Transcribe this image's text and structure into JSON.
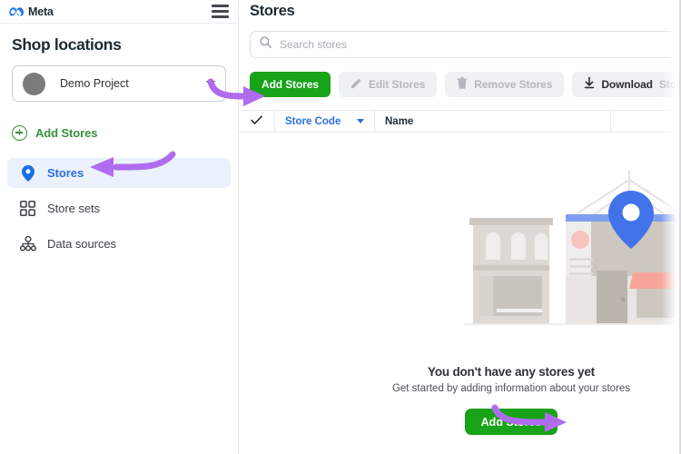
{
  "brand": {
    "name": "Meta",
    "logo_icon": "meta-infinity-icon",
    "menu_icon": "hamburger-menu-icon"
  },
  "sidebar": {
    "title": "Shop locations",
    "project_selector": {
      "name": "Demo Project",
      "avatar_icon": "avatar-circle-icon",
      "caret_icon": "chevron-down-icon"
    },
    "add_stores": {
      "label": "Add Stores",
      "icon": "plus-circle-icon",
      "color": "#3a8f3d"
    },
    "items": [
      {
        "label": "Stores",
        "icon": "location-pin-icon",
        "active": true
      },
      {
        "label": "Store sets",
        "icon": "grid-squares-icon",
        "active": false
      },
      {
        "label": "Data sources",
        "icon": "data-nodes-icon",
        "active": false
      }
    ]
  },
  "main": {
    "title": "Stores",
    "search": {
      "placeholder": "Search stores",
      "value": "",
      "icon": "search-icon"
    },
    "toolbar": [
      {
        "label": "Add Stores",
        "style": "primary",
        "icon": "",
        "enabled": true
      },
      {
        "label": "Edit Stores",
        "style": "ghost",
        "icon": "pencil-icon",
        "enabled": false
      },
      {
        "label": "Remove Stores",
        "style": "ghost",
        "icon": "trash-icon",
        "enabled": false
      },
      {
        "label": "Download",
        "label_faded": "Stores",
        "style": "ghost2",
        "icon": "download-icon",
        "enabled": true
      }
    ],
    "table": {
      "select_all_icon": "checkmark-icon",
      "columns": [
        {
          "label": "Store Code",
          "sortable": true,
          "accent": "#2f6fe0"
        },
        {
          "label": "Name",
          "sortable": false,
          "accent": "#1c2b33"
        }
      ],
      "rows": []
    },
    "empty_state": {
      "illustration": "storefront-with-map-pin-illustration",
      "heading": "You don't have any stores yet",
      "subheading": "Get started by adding information about your stores",
      "button_label": "Add Stores",
      "button_color": "#18a318"
    }
  },
  "annotations": {
    "arrow_color": "#b06cf0",
    "arrows": [
      {
        "target": "sidebar-item-stores",
        "direction": "left"
      },
      {
        "target": "toolbar-add-stores-button",
        "direction": "right"
      },
      {
        "target": "empty-state-add-stores-button",
        "direction": "right"
      }
    ]
  },
  "colors": {
    "brand_blue": "#2f6fe0",
    "green": "#18a318",
    "sidebar_active_bg": "#ebf1fd",
    "pin_blue": "#4273e8"
  }
}
